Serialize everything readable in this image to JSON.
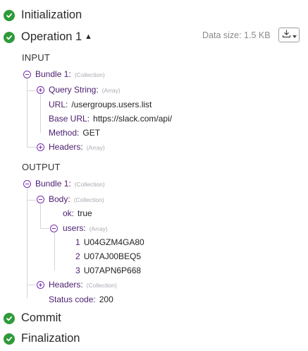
{
  "stages": {
    "initialization": "Initialization",
    "operation": "Operation 1",
    "commit": "Commit",
    "finalization": "Finalization"
  },
  "header": {
    "data_size": "Data size: 1.5 KB",
    "collapse_caret": "▲"
  },
  "input": {
    "label": "INPUT",
    "bundle": {
      "key": "Bundle 1:",
      "type": "(Collection)"
    },
    "query_string": {
      "key": "Query String:",
      "type": "(Array)"
    },
    "url": {
      "key": "URL:",
      "value": "/usergroups.users.list"
    },
    "base_url": {
      "key": "Base URL:",
      "value": "https://slack.com/api/"
    },
    "method": {
      "key": "Method:",
      "value": "GET"
    },
    "headers": {
      "key": "Headers:",
      "type": "(Array)"
    }
  },
  "output": {
    "label": "OUTPUT",
    "bundle": {
      "key": "Bundle 1:",
      "type": "(Collection)"
    },
    "body": {
      "key": "Body:",
      "type": "(Collection)"
    },
    "ok": {
      "key": "ok:",
      "value": "true"
    },
    "users": {
      "key": "users:",
      "type": "(Array)"
    },
    "user_items": [
      {
        "index": "1",
        "value": "U04GZM4GA80"
      },
      {
        "index": "2",
        "value": "U07AJ00BEQ5"
      },
      {
        "index": "3",
        "value": "U07APN6P668"
      }
    ],
    "headers": {
      "key": "Headers:",
      "type": "(Collection)"
    },
    "status_code": {
      "key": "Status code:",
      "value": "200"
    }
  },
  "icons": {
    "success": "check-circle-icon",
    "expand": "plus-circle-icon",
    "collapse": "minus-circle-icon",
    "download": "download-icon"
  },
  "colors": {
    "success": "#2f9a3a",
    "tree_accent": "#7a2fb0",
    "key_purple": "#4b1d6f",
    "type_gray": "#a9a9b3"
  }
}
